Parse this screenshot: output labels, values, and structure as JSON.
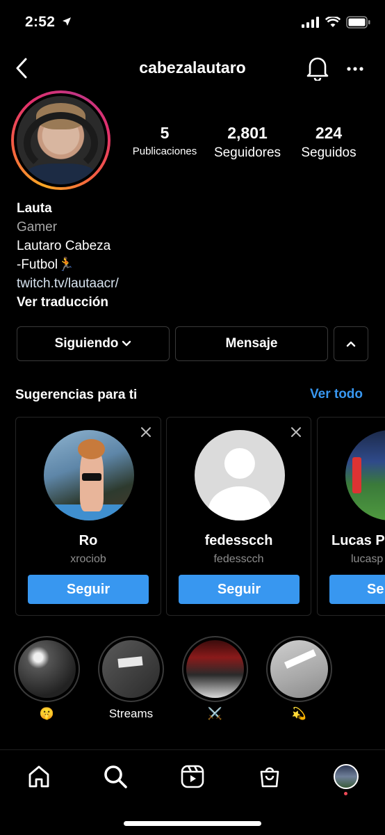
{
  "status_bar": {
    "time": "2:52"
  },
  "header": {
    "username": "cabezalautaro"
  },
  "stats": {
    "posts": {
      "value": "5",
      "label": "Publicaciones"
    },
    "followers": {
      "value": "2,801",
      "label": "Seguidores"
    },
    "following": {
      "value": "224",
      "label": "Seguidos"
    }
  },
  "bio": {
    "name": "Lauta",
    "category": "Gamer",
    "line1": "Lautaro Cabeza",
    "line2": "-Futbol🏃",
    "link": "twitch.tv/lautaacr/",
    "translate": "Ver traducción"
  },
  "actions": {
    "following_label": "Siguiendo",
    "message_label": "Mensaje"
  },
  "suggestions": {
    "title": "Sugerencias para ti",
    "see_all": "Ver todo",
    "cards": [
      {
        "name": "Ro",
        "handle": "xrociob",
        "button": "Seguir"
      },
      {
        "name": "fedesscch",
        "handle": "fedesscch",
        "button": "Seguir"
      },
      {
        "name": "Lucas P",
        "handle": "lucasp",
        "button": "Se"
      }
    ]
  },
  "highlights": [
    {
      "label": "🤫"
    },
    {
      "label": "Streams"
    },
    {
      "label": "⚔️"
    },
    {
      "label": "💫"
    }
  ],
  "tabbar": {
    "items": [
      "home-icon",
      "search-icon",
      "reels-icon",
      "shop-icon",
      "profile-avatar"
    ],
    "notification_color": "#ed4956"
  },
  "colors": {
    "accent": "#3897f0",
    "background": "#000000"
  }
}
